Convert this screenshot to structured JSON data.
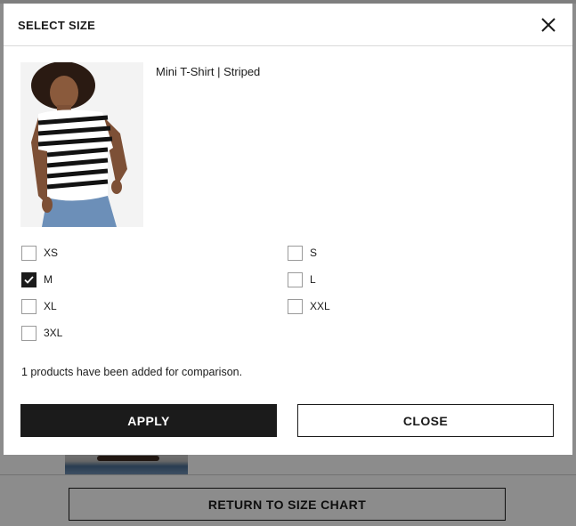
{
  "background": {
    "return_button_label": "RETURN TO SIZE CHART"
  },
  "modal": {
    "title": "SELECT SIZE",
    "close_icon": "close-icon",
    "product": {
      "name": "Mini T-Shirt | Striped"
    },
    "sizes": [
      {
        "label": "XS",
        "checked": false
      },
      {
        "label": "S",
        "checked": false
      },
      {
        "label": "M",
        "checked": true
      },
      {
        "label": "L",
        "checked": false
      },
      {
        "label": "XL",
        "checked": false
      },
      {
        "label": "XXL",
        "checked": false
      },
      {
        "label": "3XL",
        "checked": false
      }
    ],
    "compare_message": "1 products have been added for comparison.",
    "apply_label": "APPLY",
    "close_label": "CLOSE"
  },
  "colors": {
    "primary": "#1b1b1b",
    "overlay": "rgba(0,0,0,0.45)"
  }
}
